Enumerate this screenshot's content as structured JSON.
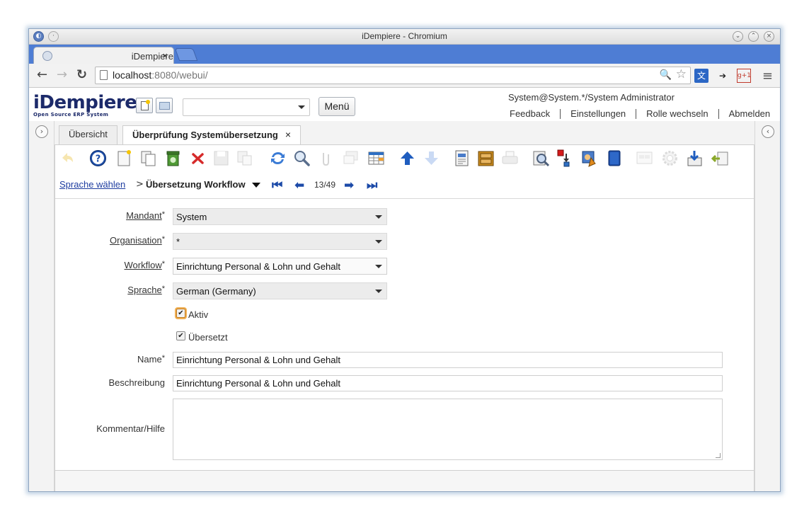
{
  "window": {
    "title": "iDempiere - Chromium"
  },
  "browser": {
    "tab_title": "iDempiere",
    "tab_close": "×",
    "url_host": "localhost",
    "url_port_path": ":8080/webui/"
  },
  "app": {
    "logo_main": "iDempiere",
    "logo_sub": "Open Source ERP System",
    "menu_button": "Menü",
    "user_info": "System@System.*/System Administrator",
    "links": [
      "Feedback",
      "Einstellungen",
      "Rolle wechseln",
      "Abmelden"
    ]
  },
  "tabs": [
    {
      "label": "Übersicht"
    },
    {
      "label": "Überprüfung Systemübersetzung",
      "close": "×"
    }
  ],
  "breadcrumb": {
    "link": "Sprache wählen",
    "separator": ">",
    "current": "Übersetzung Workflow",
    "record": "13/49"
  },
  "form": {
    "mandant": {
      "label": "Mandant",
      "req": "*",
      "value": "System"
    },
    "organisation": {
      "label": "Organisation",
      "req": "*",
      "value": "*"
    },
    "workflow": {
      "label": "Workflow",
      "req": "*",
      "value": "Einrichtung Personal & Lohn und Gehalt"
    },
    "sprache": {
      "label": "Sprache",
      "req": "*",
      "value": "German (Germany)"
    },
    "aktiv": {
      "label": "Aktiv",
      "checked": true
    },
    "uebersetzt": {
      "label": "Übersetzt",
      "checked": true
    },
    "name": {
      "label": "Name",
      "req": "*",
      "value": "Einrichtung Personal & Lohn und Gehalt"
    },
    "beschreibung": {
      "label": "Beschreibung",
      "value": "Einrichtung Personal & Lohn und Gehalt"
    },
    "kommentar": {
      "label": "Kommentar/Hilfe",
      "value": ""
    }
  },
  "colors": {
    "browser_tabstrip": "#4e7dd4",
    "logo": "#1c2a6a",
    "link": "#1e3da0",
    "nav_arrow": "#1c4aa8"
  }
}
